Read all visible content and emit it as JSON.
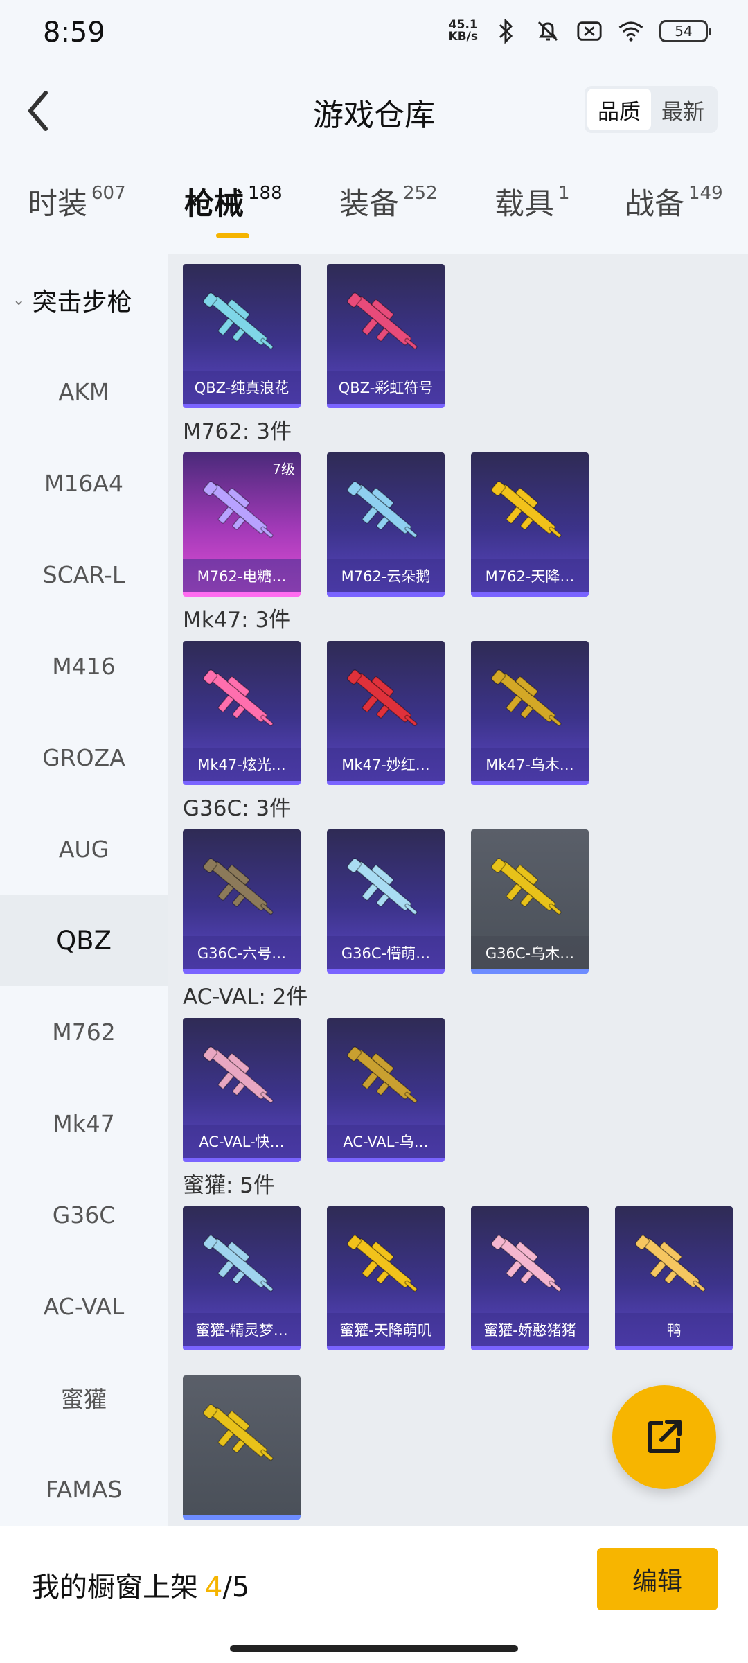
{
  "status_bar": {
    "time": "8:59",
    "net_speed_value": "45.1",
    "net_speed_unit": "KB/s",
    "battery": "54",
    "icons": [
      "bluetooth-icon",
      "mute-bell-icon",
      "no-sim-icon",
      "wifi-icon",
      "battery-icon"
    ]
  },
  "header": {
    "title": "游戏仓库",
    "sort_options": [
      "品质",
      "最新"
    ],
    "sort_selected": "品质"
  },
  "tabs": [
    {
      "label": "时装",
      "count": "607"
    },
    {
      "label": "枪械",
      "count": "188",
      "active": true
    },
    {
      "label": "装备",
      "count": "252"
    },
    {
      "label": "载具",
      "count": "1"
    },
    {
      "label": "战备",
      "count": "149"
    }
  ],
  "sidebar": {
    "header": "突击步枪",
    "items": [
      "AKM",
      "M16A4",
      "SCAR-L",
      "M416",
      "GROZA",
      "AUG",
      "QBZ",
      "M762",
      "Mk47",
      "G36C",
      "AC-VAL",
      "蜜獾",
      "FAMAS"
    ],
    "active": "QBZ"
  },
  "top_row": {
    "cards": [
      {
        "name": "QBZ-纯真浪花",
        "style": "purple",
        "gun_color": "#7fd6e8"
      },
      {
        "name": "QBZ-彩虹符号",
        "style": "purple",
        "gun_color": "#e84b7a"
      }
    ]
  },
  "sections": [
    {
      "title": "M762: 3件",
      "cards": [
        {
          "name": "M762-电糖…",
          "style": "pink",
          "level": "7级",
          "gun_color": "#b8a2ff"
        },
        {
          "name": "M762-云朵鹅",
          "style": "purple",
          "gun_color": "#8fd0f0"
        },
        {
          "name": "M762-天降…",
          "style": "purple",
          "gun_color": "#f2c21b"
        }
      ]
    },
    {
      "title": "Mk47: 3件",
      "cards": [
        {
          "name": "Mk47-炫光…",
          "style": "purple",
          "gun_color": "#ff6fae"
        },
        {
          "name": "Mk47-妙红…",
          "style": "purple",
          "gun_color": "#e0313b"
        },
        {
          "name": "Mk47-乌木…",
          "style": "purple",
          "gun_color": "#d4a826"
        }
      ]
    },
    {
      "title": "G36C: 3件",
      "cards": [
        {
          "name": "G36C-六号…",
          "style": "purple",
          "gun_color": "#8c7a5a"
        },
        {
          "name": "G36C-懵萌…",
          "style": "purple",
          "gun_color": "#a9dcf2"
        },
        {
          "name": "G36C-乌木…",
          "style": "gray",
          "gun_color": "#e8c21a"
        }
      ]
    },
    {
      "title": "AC-VAL: 2件",
      "cards": [
        {
          "name": "AC-VAL-快…",
          "style": "purple",
          "gun_color": "#e9a7c2"
        },
        {
          "name": "AC-VAL-乌…",
          "style": "purple",
          "gun_color": "#c9a030"
        }
      ]
    },
    {
      "title": "蜜獾: 5件",
      "cards": [
        {
          "name": "蜜獾-精灵梦…",
          "style": "purple",
          "gun_color": "#9fd4ee"
        },
        {
          "name": "蜜獾-天降萌叽",
          "style": "purple",
          "gun_color": "#f2c21b"
        },
        {
          "name": "蜜獾-娇憨猪猪",
          "style": "purple",
          "gun_color": "#f5b6cf"
        },
        {
          "name": "鸭",
          "style": "purple",
          "gun_color": "#f6c660"
        }
      ]
    }
  ],
  "partial_card": {
    "style": "gray",
    "gun_color": "#e8c21a"
  },
  "bottom_bar": {
    "label": "我的橱窗上架",
    "current": "4",
    "total": "/5",
    "edit_button": "编辑"
  },
  "colors": {
    "accent": "#f7b500",
    "card_purple": "#3c338a",
    "card_pink": "#e04fd6",
    "card_gray": "#4a5059"
  }
}
